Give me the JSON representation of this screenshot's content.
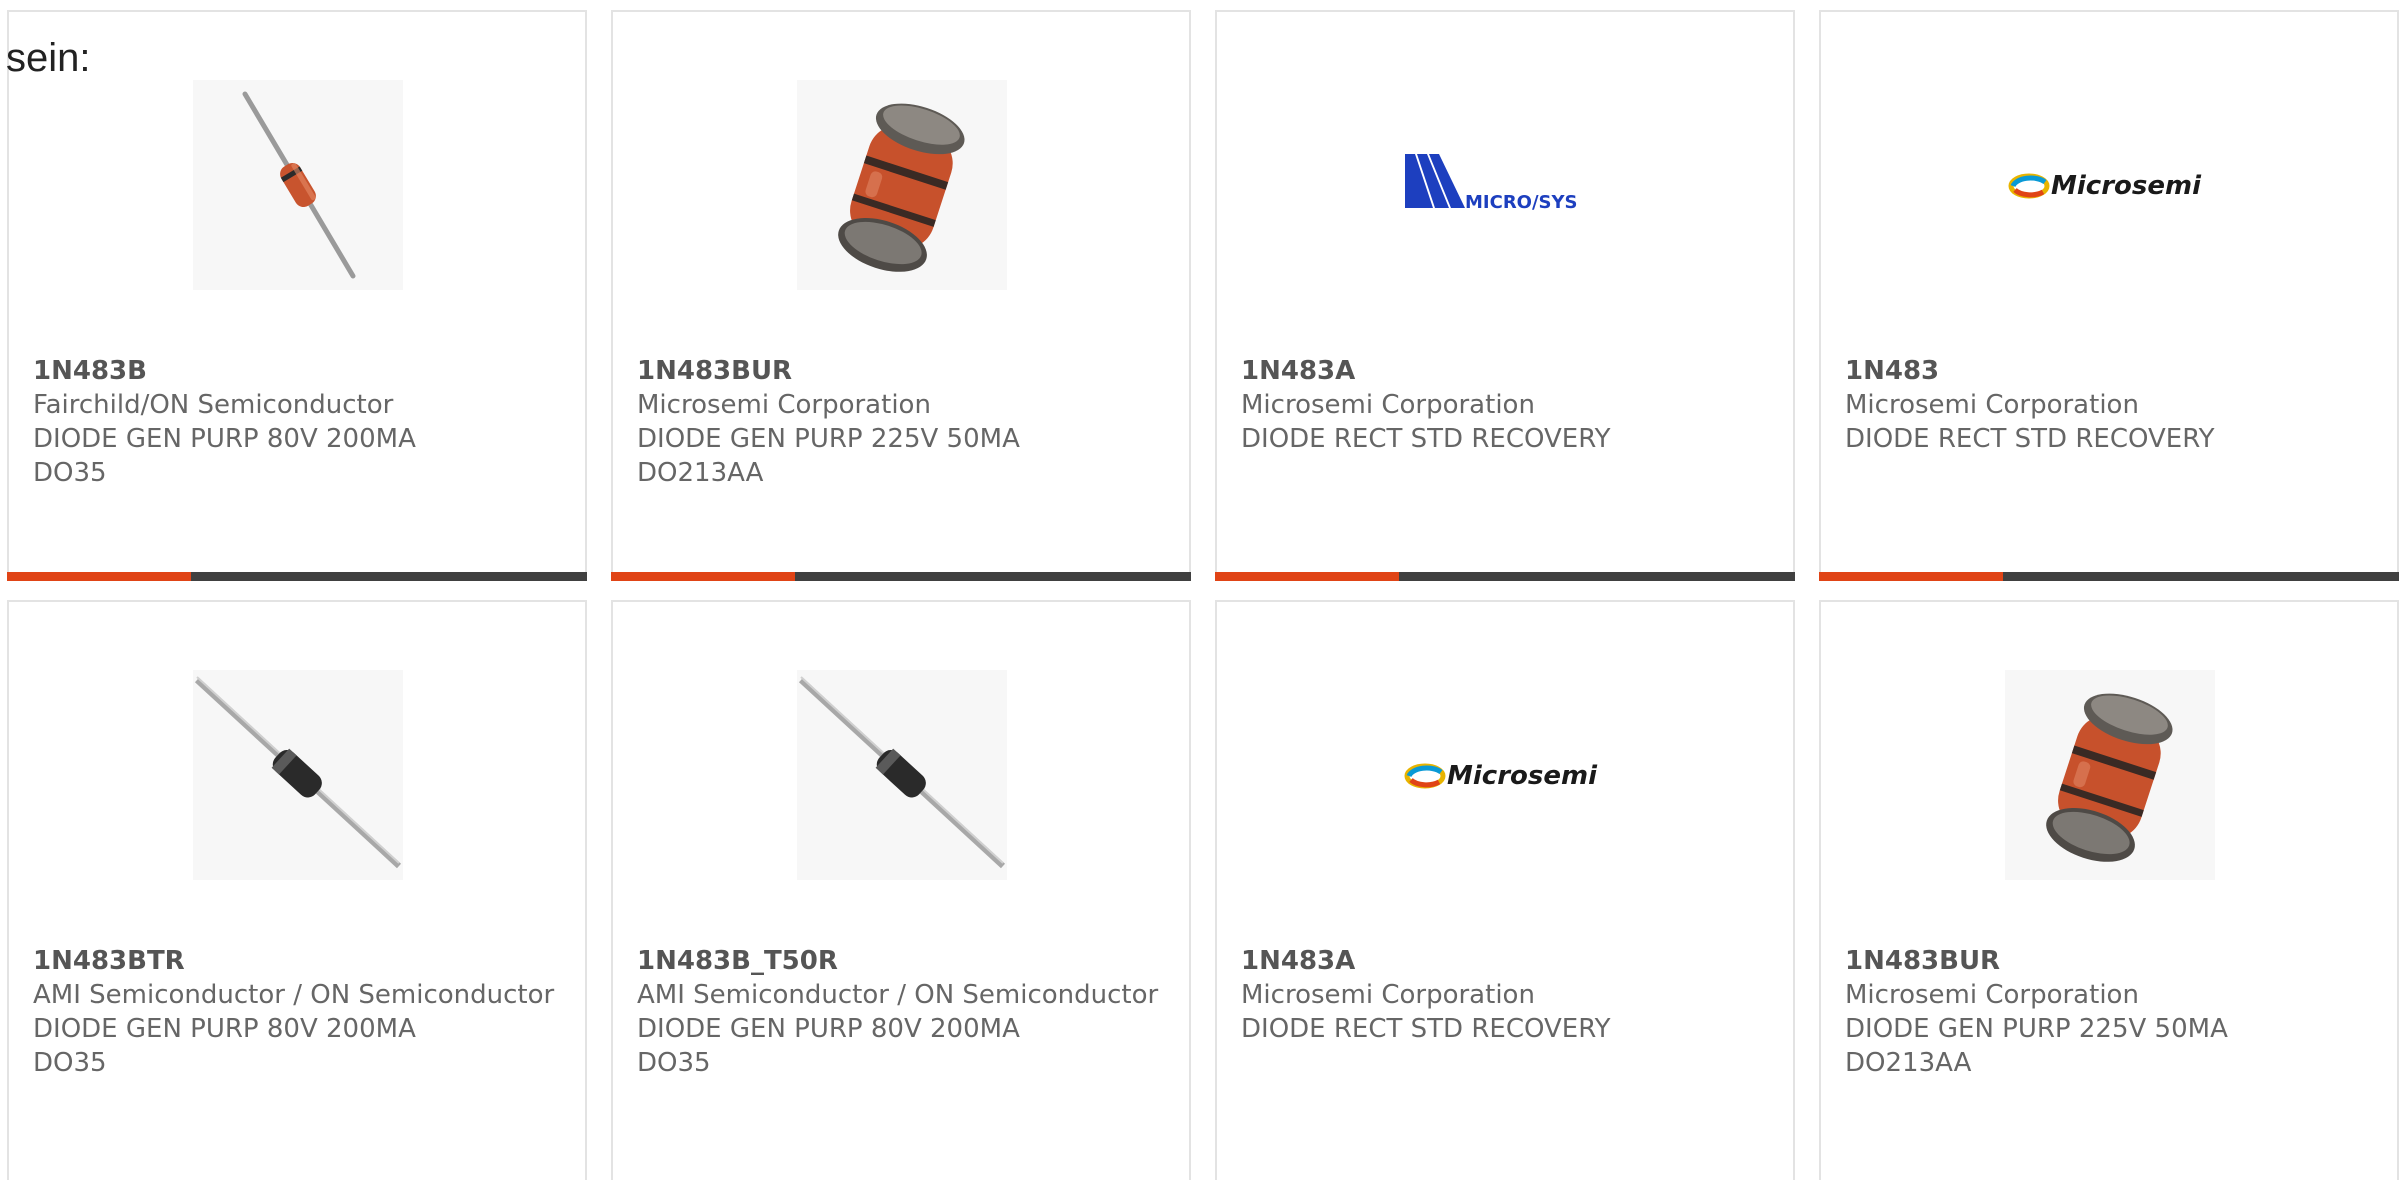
{
  "lead_text": "sein:",
  "colors": {
    "accent": "#e04416",
    "bar": "#404040",
    "card_border": "#e3e3e3",
    "text": "#666666"
  },
  "cards": [
    {
      "part": "1N483B",
      "manufacturer": "Fairchild/ON Semiconductor",
      "description": "DIODE GEN PURP 80V 200MA",
      "package": "DO35",
      "image": "axial-diode-orange-icon"
    },
    {
      "part": "1N483BUR",
      "manufacturer": "Microsemi Corporation",
      "description": "DIODE GEN PURP 225V 50MA",
      "package": "DO213AA",
      "image": "melf-diode-icon"
    },
    {
      "part": "1N483A",
      "manufacturer": "Microsemi Corporation",
      "description": "DIODE RECT STD RECOVERY",
      "package": "",
      "image": "microsys-logo",
      "logo_text": "MICRO/SYS"
    },
    {
      "part": "1N483",
      "manufacturer": "Microsemi Corporation",
      "description": "DIODE RECT STD RECOVERY",
      "package": "",
      "image": "microsemi-logo",
      "logo_text": "Microsemi"
    },
    {
      "part": "1N483BTR",
      "manufacturer": "AMI Semiconductor / ON Semiconductor",
      "description": "DIODE GEN PURP 80V 200MA",
      "package": "DO35",
      "image": "axial-diode-black-icon"
    },
    {
      "part": "1N483B_T50R",
      "manufacturer": "AMI Semiconductor / ON Semiconductor",
      "description": "DIODE GEN PURP 80V 200MA",
      "package": "DO35",
      "image": "axial-diode-black-icon"
    },
    {
      "part": "1N483A",
      "manufacturer": "Microsemi Corporation",
      "description": "DIODE RECT STD RECOVERY",
      "package": "",
      "image": "microsemi-logo",
      "logo_text": "Microsemi"
    },
    {
      "part": "1N483BUR",
      "manufacturer": "Microsemi Corporation",
      "description": "DIODE GEN PURP 225V 50MA",
      "package": "DO213AA",
      "image": "melf-diode-icon"
    }
  ]
}
